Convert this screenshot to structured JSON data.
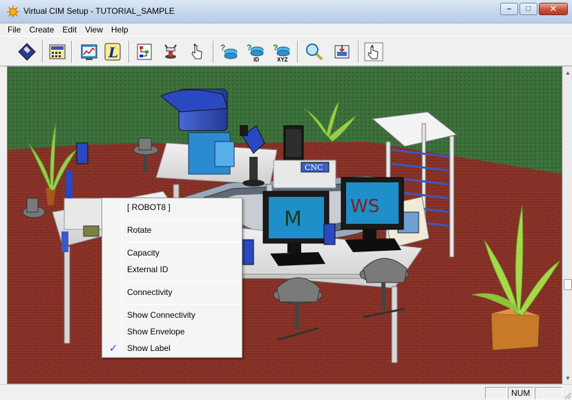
{
  "window": {
    "title": "Virtual CIM Setup  - TUTORIAL_SAMPLE",
    "minimize_glyph": "–",
    "maximize_glyph": "□",
    "close_glyph": "✕"
  },
  "menubar": {
    "items": [
      "File",
      "Create",
      "Edit",
      "View",
      "Help"
    ]
  },
  "toolbar": {
    "icons": [
      "save-disk-icon",
      "calculator-panel-icon",
      "chart-screen-icon",
      "robot-program-l-icon",
      "flowchart-icon",
      "robot-arm-icon",
      "hand-pointer-icon",
      "query-device-icon",
      "query-id-icon",
      "query-xyz-icon",
      "magnify-icon",
      "export-screen-icon",
      "hand-grab-icon"
    ]
  },
  "scene": {
    "monitor_m_label": "M",
    "monitor_ws_label": "WS",
    "cnc_label": "CNC",
    "colors": {
      "grass": "#3b6f3b",
      "floor": "#7b2b22",
      "table": "#e2e2e2",
      "robot_blue": "#2f4fb8",
      "monitor_screen": "#1e8fc9"
    }
  },
  "context_menu": {
    "header": "[ ROBOT8 ]",
    "rotate": "Rotate",
    "capacity": "Capacity",
    "external_id": "External ID",
    "connectivity": "Connectivity",
    "show_connectivity": "Show Connectivity",
    "show_envelope": "Show Envelope",
    "show_label": "Show Label",
    "show_label_checked": true,
    "check_glyph": "✓"
  },
  "statusbar": {
    "num_indicator": "NUM"
  },
  "scrollbar": {
    "up_glyph": "▲",
    "down_glyph": "▼"
  }
}
